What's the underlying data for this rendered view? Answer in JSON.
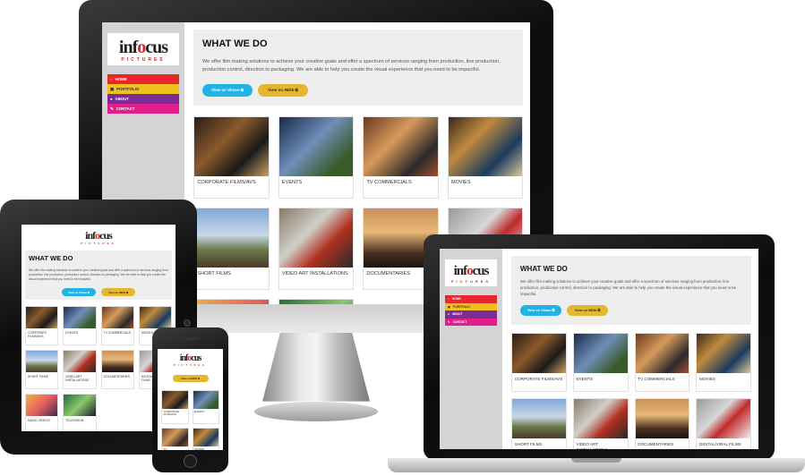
{
  "site": {
    "logo_word_a": "inf",
    "logo_word_b": "o",
    "logo_word_c": "cus",
    "logo_sub": "PICTURES",
    "nav": [
      {
        "label": "HOME",
        "color": "#e8262d",
        "icon": "home-icon"
      },
      {
        "label": "PORTFOLIO",
        "color": "#f0c01c",
        "icon": "briefcase-icon"
      },
      {
        "label": "ABOUT",
        "color": "#7a2b95",
        "icon": "user-icon"
      },
      {
        "label": "CONTACT",
        "color": "#e01f8a",
        "icon": "pencil-icon"
      }
    ],
    "title": "WHAT WE DO",
    "intro": "We offer film making solutions to achieve your creative goals and offer a spectrum of services ranging from production, line production, production control, direction to packaging. We are able to help you create the visual experience that you need to be impactful.",
    "btn_vimeo": "View on Vimeo ⧉",
    "btn_imdb": "View on IMDb ⧉",
    "categories": [
      "CORPORATE FILMS/AVS",
      "EVENTS",
      "TV COMMERCIALS",
      "MOVIES",
      "SHORT FILMS",
      "VIDEO ART INSTALLATIONS",
      "DOCUMENTARIES",
      "DIGITAL/VIRAL FILMS",
      "MUSIC VIDEOS",
      "TELEVISION"
    ]
  },
  "colors": {
    "accent_vimeo": "#23b2e6",
    "accent_imdb": "#e5b630",
    "sidebar": "#d4d4d4"
  }
}
